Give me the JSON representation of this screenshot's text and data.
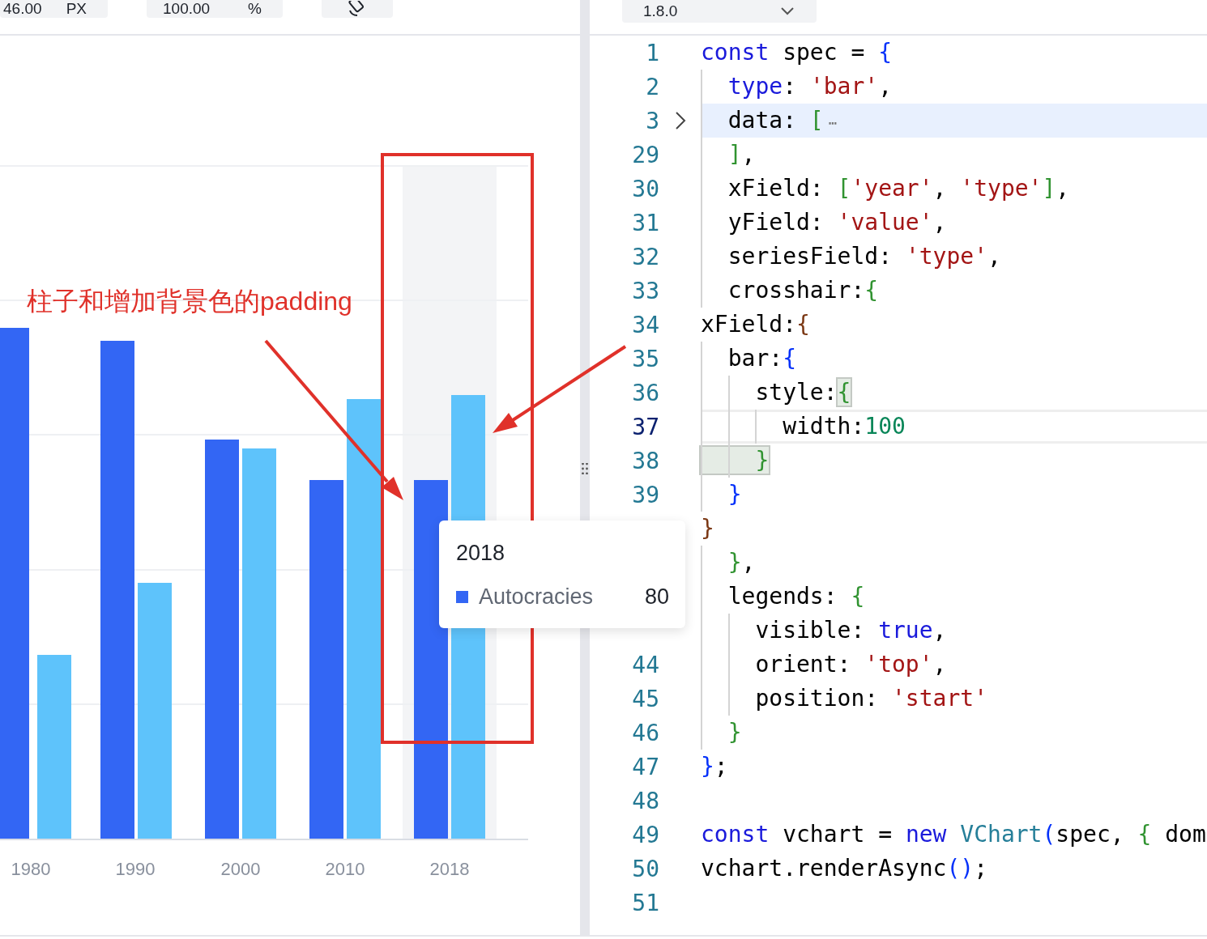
{
  "preview_toolbar": {
    "size_fields": [
      {
        "value": "46.00",
        "unit": "PX"
      },
      {
        "value": "100.00",
        "unit": "%"
      }
    ]
  },
  "chart": {
    "x_labels": [
      "1980",
      "1990",
      "2000",
      "2010",
      "2018"
    ],
    "tooltip": {
      "title": "2018",
      "series_name": "Autocracies",
      "value": "80"
    },
    "annotation": "柱子和增加背景色的padding"
  },
  "editor_toolbar": {
    "version_select": {
      "value": "1.8.0"
    }
  },
  "editor": {
    "lines": [
      {
        "number": "1",
        "folded": false,
        "highlighted": false,
        "current": false,
        "tokens": [
          {
            "kind": "kw",
            "text": "const"
          },
          {
            "kind": "p",
            "text": " spec = "
          },
          {
            "kind": "b1",
            "text": "{"
          }
        ]
      },
      {
        "number": "2",
        "folded": false,
        "highlighted": false,
        "current": false,
        "tokens": [
          {
            "kind": "kw",
            "text": "  type"
          },
          {
            "kind": "p",
            "text": ": "
          },
          {
            "kind": "str",
            "text": "'bar'"
          },
          {
            "kind": "p",
            "text": ","
          }
        ]
      },
      {
        "number": "3",
        "folded": true,
        "highlighted": true,
        "current": false,
        "tokens": [
          {
            "kind": "p",
            "text": "  data: "
          },
          {
            "kind": "b2",
            "text": "["
          },
          {
            "kind": "fold",
            "text": "⋯"
          }
        ]
      },
      {
        "number": "29",
        "folded": false,
        "highlighted": false,
        "current": false,
        "tokens": [
          {
            "kind": "b2",
            "text": "  ]"
          },
          {
            "kind": "p",
            "text": ","
          }
        ]
      },
      {
        "number": "30",
        "folded": false,
        "highlighted": false,
        "current": false,
        "tokens": [
          {
            "kind": "p",
            "text": "  xField: "
          },
          {
            "kind": "b2",
            "text": "["
          },
          {
            "kind": "str",
            "text": "'year'"
          },
          {
            "kind": "p",
            "text": ", "
          },
          {
            "kind": "str",
            "text": "'type'"
          },
          {
            "kind": "b2",
            "text": "]"
          },
          {
            "kind": "p",
            "text": ","
          }
        ]
      },
      {
        "number": "31",
        "folded": false,
        "highlighted": false,
        "current": false,
        "tokens": [
          {
            "kind": "p",
            "text": "  yField: "
          },
          {
            "kind": "str",
            "text": "'value'"
          },
          {
            "kind": "p",
            "text": ","
          }
        ]
      },
      {
        "number": "32",
        "folded": false,
        "highlighted": false,
        "current": false,
        "tokens": [
          {
            "kind": "p",
            "text": "  seriesField: "
          },
          {
            "kind": "str",
            "text": "'type'"
          },
          {
            "kind": "p",
            "text": ","
          }
        ]
      },
      {
        "number": "33",
        "folded": false,
        "highlighted": false,
        "current": false,
        "tokens": [
          {
            "kind": "p",
            "text": "  crosshair:"
          },
          {
            "kind": "b2",
            "text": "{"
          }
        ]
      },
      {
        "number": "34",
        "folded": false,
        "highlighted": false,
        "current": false,
        "tokens": [
          {
            "kind": "p",
            "text": "xField:"
          },
          {
            "kind": "b3",
            "text": "{"
          }
        ]
      },
      {
        "number": "35",
        "folded": false,
        "highlighted": false,
        "current": false,
        "tokens": [
          {
            "kind": "p",
            "text": "  bar:"
          },
          {
            "kind": "b1",
            "text": "{"
          }
        ]
      },
      {
        "number": "36",
        "folded": false,
        "highlighted": false,
        "current": false,
        "tokens": [
          {
            "kind": "p",
            "text": "    style:"
          },
          {
            "kind": "match",
            "text": "{"
          }
        ]
      },
      {
        "number": "37",
        "folded": false,
        "highlighted": false,
        "current": true,
        "tokens": [
          {
            "kind": "p",
            "text": "      width:"
          },
          {
            "kind": "num",
            "text": "100"
          }
        ]
      },
      {
        "number": "38",
        "folded": false,
        "highlighted": false,
        "current": false,
        "tokens": [
          {
            "kind": "match",
            "text": "    }"
          }
        ]
      },
      {
        "number": "39",
        "folded": false,
        "highlighted": false,
        "current": false,
        "tokens": [
          {
            "kind": "b1",
            "text": "  }"
          }
        ]
      },
      {
        "folded": false,
        "highlighted": false,
        "current": false,
        "tokens": [
          {
            "kind": "b3",
            "text": "}"
          }
        ]
      },
      {
        "folded": false,
        "highlighted": false,
        "current": false,
        "tokens": [
          {
            "kind": "b2",
            "text": "  }"
          },
          {
            "kind": "p",
            "text": ","
          }
        ]
      },
      {
        "folded": false,
        "highlighted": false,
        "current": false,
        "tokens": [
          {
            "kind": "p",
            "text": "  legends: "
          },
          {
            "kind": "b2",
            "text": "{"
          }
        ]
      },
      {
        "folded": false,
        "highlighted": false,
        "current": false,
        "tokens": [
          {
            "kind": "p",
            "text": "    visible: "
          },
          {
            "kind": "kw",
            "text": "true"
          },
          {
            "kind": "p",
            "text": ","
          }
        ]
      },
      {
        "number": "44",
        "folded": false,
        "highlighted": false,
        "current": false,
        "tokens": [
          {
            "kind": "p",
            "text": "    orient: "
          },
          {
            "kind": "str",
            "text": "'top'"
          },
          {
            "kind": "p",
            "text": ","
          }
        ]
      },
      {
        "number": "45",
        "folded": false,
        "highlighted": false,
        "current": false,
        "tokens": [
          {
            "kind": "p",
            "text": "    position: "
          },
          {
            "kind": "str",
            "text": "'start'"
          }
        ]
      },
      {
        "number": "46",
        "folded": false,
        "highlighted": false,
        "current": false,
        "tokens": [
          {
            "kind": "b2",
            "text": "  }"
          }
        ]
      },
      {
        "number": "47",
        "folded": false,
        "highlighted": false,
        "current": false,
        "tokens": [
          {
            "kind": "b1",
            "text": "}"
          },
          {
            "kind": "p",
            "text": ";"
          }
        ]
      },
      {
        "number": "48",
        "folded": false,
        "highlighted": false,
        "current": false
      },
      {
        "number": "49",
        "folded": false,
        "highlighted": false,
        "current": false,
        "tokens": [
          {
            "kind": "kw",
            "text": "const"
          },
          {
            "kind": "p",
            "text": " vchart = "
          },
          {
            "kind": "kw",
            "text": "new "
          },
          {
            "kind": "cls",
            "text": "VChart"
          },
          {
            "kind": "b1",
            "text": "("
          },
          {
            "kind": "p",
            "text": "spec, "
          },
          {
            "kind": "b2",
            "text": "{"
          },
          {
            "kind": "p",
            "text": " dom"
          }
        ]
      },
      {
        "number": "50",
        "folded": false,
        "highlighted": false,
        "current": false,
        "tokens": [
          {
            "kind": "p",
            "text": "vchart.renderAsync"
          },
          {
            "kind": "b1",
            "text": "()"
          },
          {
            "kind": "p",
            "text": ";"
          }
        ]
      },
      {
        "number": "51",
        "folded": false,
        "highlighted": false,
        "current": false
      }
    ]
  }
}
